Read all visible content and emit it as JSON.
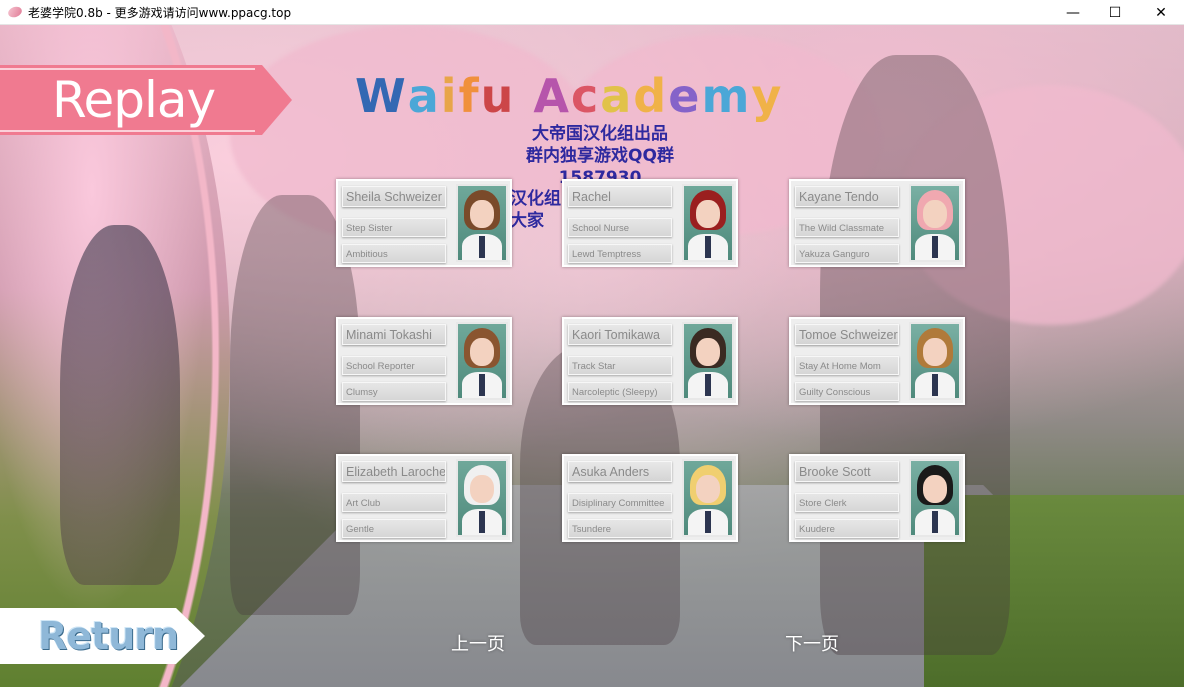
{
  "window": {
    "title": "老婆学院0.8b - 更多游戏请访问www.ppacg.top",
    "minimize": "—",
    "maximize": "☐",
    "close": "✕"
  },
  "header": {
    "replay_label": "Replay",
    "logo_text": "Waifu Academy",
    "logo_colors": [
      "#1f5fb0",
      "#3aa5d8",
      "#e8a33b",
      "#f08c2c",
      "#c93a3a",
      "#b04aa8",
      "#d94b5a",
      "#e0c33b",
      "#f0b23a",
      "#7a5ac9",
      "#3aa5d8",
      "#f0b23a",
      "#5bb04a"
    ],
    "watermark_lines": [
      "大帝国汉化组出品",
      "群内独享游戏QQ群",
      "1587930",
      "汉化组",
      "大家"
    ]
  },
  "characters": [
    {
      "name": "Sheila Schweizer",
      "role": "Step Sister",
      "trait": "Ambitious",
      "hair_color": "#7a4a2a",
      "bg_color": "#6fa89a"
    },
    {
      "name": "Rachel",
      "role": "School Nurse",
      "trait": "Lewd Temptress",
      "hair_color": "#9a1f1f",
      "bg_color": "#6fa89a"
    },
    {
      "name": "Kayane Tendo",
      "role": "The Wild Classmate",
      "trait": "Yakuza Ganguro",
      "hair_color": "#f0a8b0",
      "bg_color": "#7ab0a4"
    },
    {
      "name": "Minami Tokashi",
      "role": "School Reporter",
      "trait": "Clumsy",
      "hair_color": "#8a5530",
      "bg_color": "#6fa89a"
    },
    {
      "name": "Kaori Tomikawa",
      "role": "Track Star",
      "trait": "Narcoleptic (Sleepy)",
      "hair_color": "#3a2a22",
      "bg_color": "#6fa89a"
    },
    {
      "name": "Tomoe Schweizer",
      "role": "Stay At Home Mom",
      "trait": "Guilty Conscious",
      "hair_color": "#b07a3a",
      "bg_color": "#7ab0a4"
    },
    {
      "name": "Elizabeth Laroche",
      "role": "Art Club",
      "trait": "Gentle",
      "hair_color": "#f0f0f0",
      "bg_color": "#6fa89a"
    },
    {
      "name": "Asuka Anders",
      "role": "Disiplinary  Committee",
      "trait": "Tsundere",
      "hair_color": "#f0cf70",
      "bg_color": "#6fa89a"
    },
    {
      "name": "Brooke Scott",
      "role": "Store Clerk",
      "trait": "Kuudere",
      "hair_color": "#1a1a1a",
      "bg_color": "#7ab0a4"
    }
  ],
  "footer": {
    "return_label": "Return",
    "prev_page": "上一页",
    "next_page": "下一页"
  }
}
